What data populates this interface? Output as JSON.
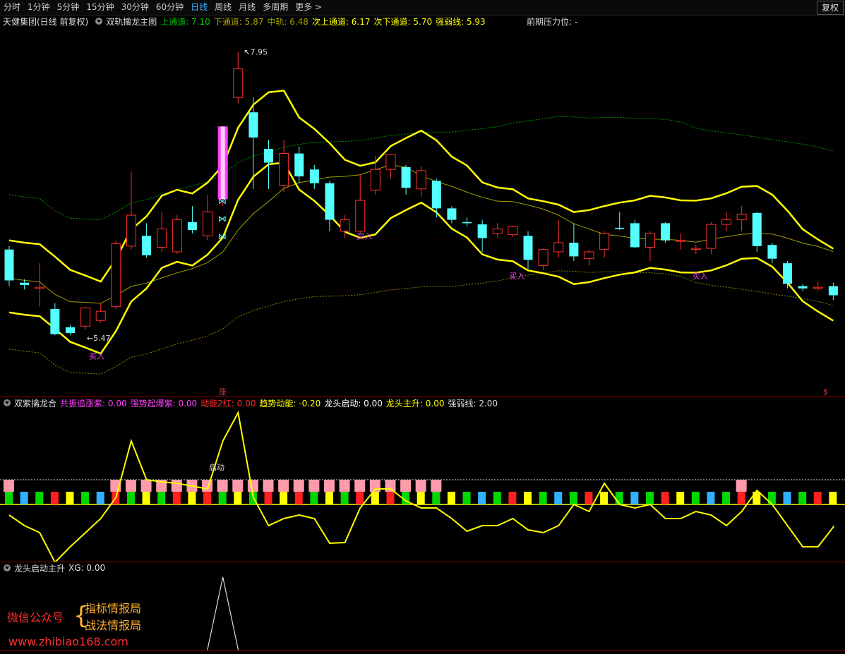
{
  "toolbar": {
    "tabs": [
      "分时",
      "1分钟",
      "5分钟",
      "15分钟",
      "30分钟",
      "60分钟",
      "日线",
      "周线",
      "月线",
      "多周期",
      "更多 >"
    ],
    "active_tab": "日线",
    "restore_button": "复权"
  },
  "main_panel": {
    "stock": "天健集团(日线 前复权)",
    "indicator": "双轨擒龙主图",
    "legend": [
      {
        "label": "上通道:",
        "value": "7.10",
        "color": "#00c800"
      },
      {
        "label": "下通道:",
        "value": "5.87",
        "color": "#b4a000"
      },
      {
        "label": "中轨:",
        "value": "6.48",
        "color": "#a0a000"
      },
      {
        "label": "次上通道:",
        "value": "6.17",
        "color": "#ffff00"
      },
      {
        "label": "次下通道:",
        "value": "5.70",
        "color": "#ffff00"
      },
      {
        "label": "强弱线:",
        "value": "5.93",
        "color": "#ffff00"
      }
    ],
    "pressure_label": "前期压力位: -",
    "high_label": "7.95",
    "low_label": "5.47",
    "buy_label": "买入",
    "rise_label": "涨",
    "s_label": "$"
  },
  "sub_panel1": {
    "name": "双紫擒龙合",
    "items": [
      {
        "label": "共振追涨紫:",
        "value": "0.00",
        "color": "#ff40ff"
      },
      {
        "label": "强势起爆紫:",
        "value": "0.00",
        "color": "#ff40ff"
      },
      {
        "label": "动能2红:",
        "value": "0.00",
        "color": "#ff3030"
      },
      {
        "label": "趋势动能:",
        "value": "-0.20",
        "color": "#ffff00"
      },
      {
        "label": "龙头启动:",
        "value": "0.00",
        "color": "#ffffff"
      },
      {
        "label": "龙头主升:",
        "value": "0.00",
        "color": "#ffff00"
      },
      {
        "label": "强弱线:",
        "value": "2.00",
        "color": "#dddddd"
      }
    ],
    "start_label": "启动"
  },
  "sub_panel2": {
    "name": "龙头启动主升",
    "xg": "XG: 0.00"
  },
  "watermark": {
    "left": "微信公众号",
    "line1": "指标情报局",
    "line2": "战法情报局",
    "url": "www.zhibiao168.com"
  },
  "colors": {
    "up": "#ff3030",
    "down": "#54ffff",
    "yellow": "#ffff00",
    "magenta": "#ff40ff"
  },
  "chart_data": {
    "type": "candlestick",
    "price_range": [
      5.2,
      8.1
    ],
    "candles": [
      {
        "o": 6.22,
        "c": 5.95,
        "h": 6.25,
        "l": 5.9
      },
      {
        "o": 5.93,
        "c": 5.91,
        "h": 5.96,
        "l": 5.87
      },
      {
        "o": 5.88,
        "c": 5.89,
        "h": 6.1,
        "l": 5.72
      },
      {
        "o": 5.7,
        "c": 5.48,
        "h": 5.75,
        "l": 5.47
      },
      {
        "o": 5.54,
        "c": 5.49,
        "h": 5.56,
        "l": 5.47
      },
      {
        "o": 5.55,
        "c": 5.71,
        "h": 5.72,
        "l": 5.52
      },
      {
        "o": 5.6,
        "c": 5.68,
        "h": 5.75,
        "l": 5.58
      },
      {
        "o": 5.72,
        "c": 6.27,
        "h": 6.3,
        "l": 5.7
      },
      {
        "o": 6.25,
        "c": 6.52,
        "h": 6.9,
        "l": 6.22
      },
      {
        "o": 6.34,
        "c": 6.17,
        "h": 6.45,
        "l": 6.15
      },
      {
        "o": 6.24,
        "c": 6.4,
        "h": 6.55,
        "l": 6.2
      },
      {
        "o": 6.2,
        "c": 6.48,
        "h": 6.52,
        "l": 6.18
      },
      {
        "o": 6.46,
        "c": 6.39,
        "h": 6.6,
        "l": 6.36
      },
      {
        "o": 6.34,
        "c": 6.55,
        "h": 6.7,
        "l": 6.3
      },
      {
        "o": 6.66,
        "c": 7.0,
        "h": 7.05,
        "l": 6.6
      },
      {
        "o": 7.55,
        "c": 7.8,
        "h": 7.95,
        "l": 7.5
      },
      {
        "o": 7.42,
        "c": 7.2,
        "h": 7.55,
        "l": 6.75
      },
      {
        "o": 7.1,
        "c": 6.98,
        "h": 7.18,
        "l": 6.75
      },
      {
        "o": 6.78,
        "c": 7.06,
        "h": 7.18,
        "l": 6.72
      },
      {
        "o": 7.06,
        "c": 6.86,
        "h": 7.12,
        "l": 6.8
      },
      {
        "o": 6.92,
        "c": 6.8,
        "h": 6.96,
        "l": 6.75
      },
      {
        "o": 6.8,
        "c": 6.48,
        "h": 6.82,
        "l": 6.38
      },
      {
        "o": 6.38,
        "c": 6.48,
        "h": 6.52,
        "l": 6.32
      },
      {
        "o": 6.38,
        "c": 6.65,
        "h": 6.88,
        "l": 6.36
      },
      {
        "o": 6.74,
        "c": 6.92,
        "h": 7.04,
        "l": 6.7
      },
      {
        "o": 6.92,
        "c": 7.05,
        "h": 7.05,
        "l": 6.84
      },
      {
        "o": 6.94,
        "c": 6.76,
        "h": 6.96,
        "l": 6.7
      },
      {
        "o": 6.75,
        "c": 6.91,
        "h": 6.95,
        "l": 6.68
      },
      {
        "o": 6.82,
        "c": 6.58,
        "h": 6.84,
        "l": 6.5
      },
      {
        "o": 6.58,
        "c": 6.48,
        "h": 6.6,
        "l": 6.45
      },
      {
        "o": 6.46,
        "c": 6.45,
        "h": 6.5,
        "l": 6.42
      },
      {
        "o": 6.44,
        "c": 6.32,
        "h": 6.48,
        "l": 6.2
      },
      {
        "o": 6.36,
        "c": 6.4,
        "h": 6.45,
        "l": 6.33
      },
      {
        "o": 6.35,
        "c": 6.42,
        "h": 6.43,
        "l": 6.33
      },
      {
        "o": 6.34,
        "c": 6.13,
        "h": 6.38,
        "l": 6.05
      },
      {
        "o": 6.08,
        "c": 6.22,
        "h": 6.23,
        "l": 6.04
      },
      {
        "o": 6.2,
        "c": 6.28,
        "h": 6.48,
        "l": 6.15
      },
      {
        "o": 6.28,
        "c": 6.16,
        "h": 6.45,
        "l": 6.12
      },
      {
        "o": 6.14,
        "c": 6.2,
        "h": 6.22,
        "l": 6.08
      },
      {
        "o": 6.22,
        "c": 6.36,
        "h": 6.38,
        "l": 6.15
      },
      {
        "o": 6.41,
        "c": 6.4,
        "h": 6.55,
        "l": 6.39
      },
      {
        "o": 6.45,
        "c": 6.24,
        "h": 6.48,
        "l": 6.23
      },
      {
        "o": 6.24,
        "c": 6.36,
        "h": 6.38,
        "l": 6.12
      },
      {
        "o": 6.45,
        "c": 6.3,
        "h": 6.46,
        "l": 6.28
      },
      {
        "o": 6.3,
        "c": 6.3,
        "h": 6.36,
        "l": 6.22
      },
      {
        "o": 6.23,
        "c": 6.23,
        "h": 6.26,
        "l": 6.18
      },
      {
        "o": 6.23,
        "c": 6.44,
        "h": 6.46,
        "l": 6.18
      },
      {
        "o": 6.44,
        "c": 6.48,
        "h": 6.55,
        "l": 6.38
      },
      {
        "o": 6.48,
        "c": 6.53,
        "h": 6.6,
        "l": 6.38
      },
      {
        "o": 6.54,
        "c": 6.25,
        "h": 6.55,
        "l": 6.2
      },
      {
        "o": 6.26,
        "c": 6.14,
        "h": 6.28,
        "l": 6.1
      },
      {
        "o": 6.1,
        "c": 5.92,
        "h": 6.12,
        "l": 5.88
      },
      {
        "o": 5.9,
        "c": 5.88,
        "h": 5.92,
        "l": 5.86
      },
      {
        "o": 5.88,
        "c": 5.89,
        "h": 5.94,
        "l": 5.86
      },
      {
        "o": 5.9,
        "c": 5.82,
        "h": 5.93,
        "l": 5.78
      }
    ]
  }
}
